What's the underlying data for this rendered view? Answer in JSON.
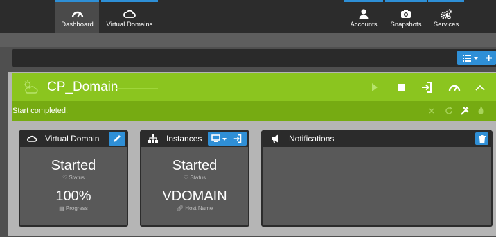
{
  "nav": {
    "left": [
      {
        "label": "Dashboard",
        "icon": "speedometer-icon",
        "active": true
      },
      {
        "label": "Virtual Domains",
        "icon": "cloud-icon",
        "active": false
      }
    ],
    "right": [
      {
        "label": "Accounts",
        "icon": "user-icon"
      },
      {
        "label": "Snapshots",
        "icon": "camera-icon"
      },
      {
        "label": "Services",
        "icon": "gears-icon"
      }
    ]
  },
  "domain": {
    "name": "CP_Domain",
    "status_message": "Start completed."
  },
  "cards": {
    "virtual_domain": {
      "title": "Virtual Domain",
      "value1": "Started",
      "caption1": "Status",
      "value2": "100%",
      "caption2": "Progress"
    },
    "instances": {
      "title": "Instances",
      "value1": "Started",
      "caption1": "Status",
      "value2": "VDOMAIN",
      "caption2": "Host Name"
    },
    "notifications": {
      "title": "Notifications"
    }
  },
  "colors": {
    "accent": "#2f8fd6",
    "domain_header": "#8bc51f",
    "status_bar": "#76ab12"
  }
}
